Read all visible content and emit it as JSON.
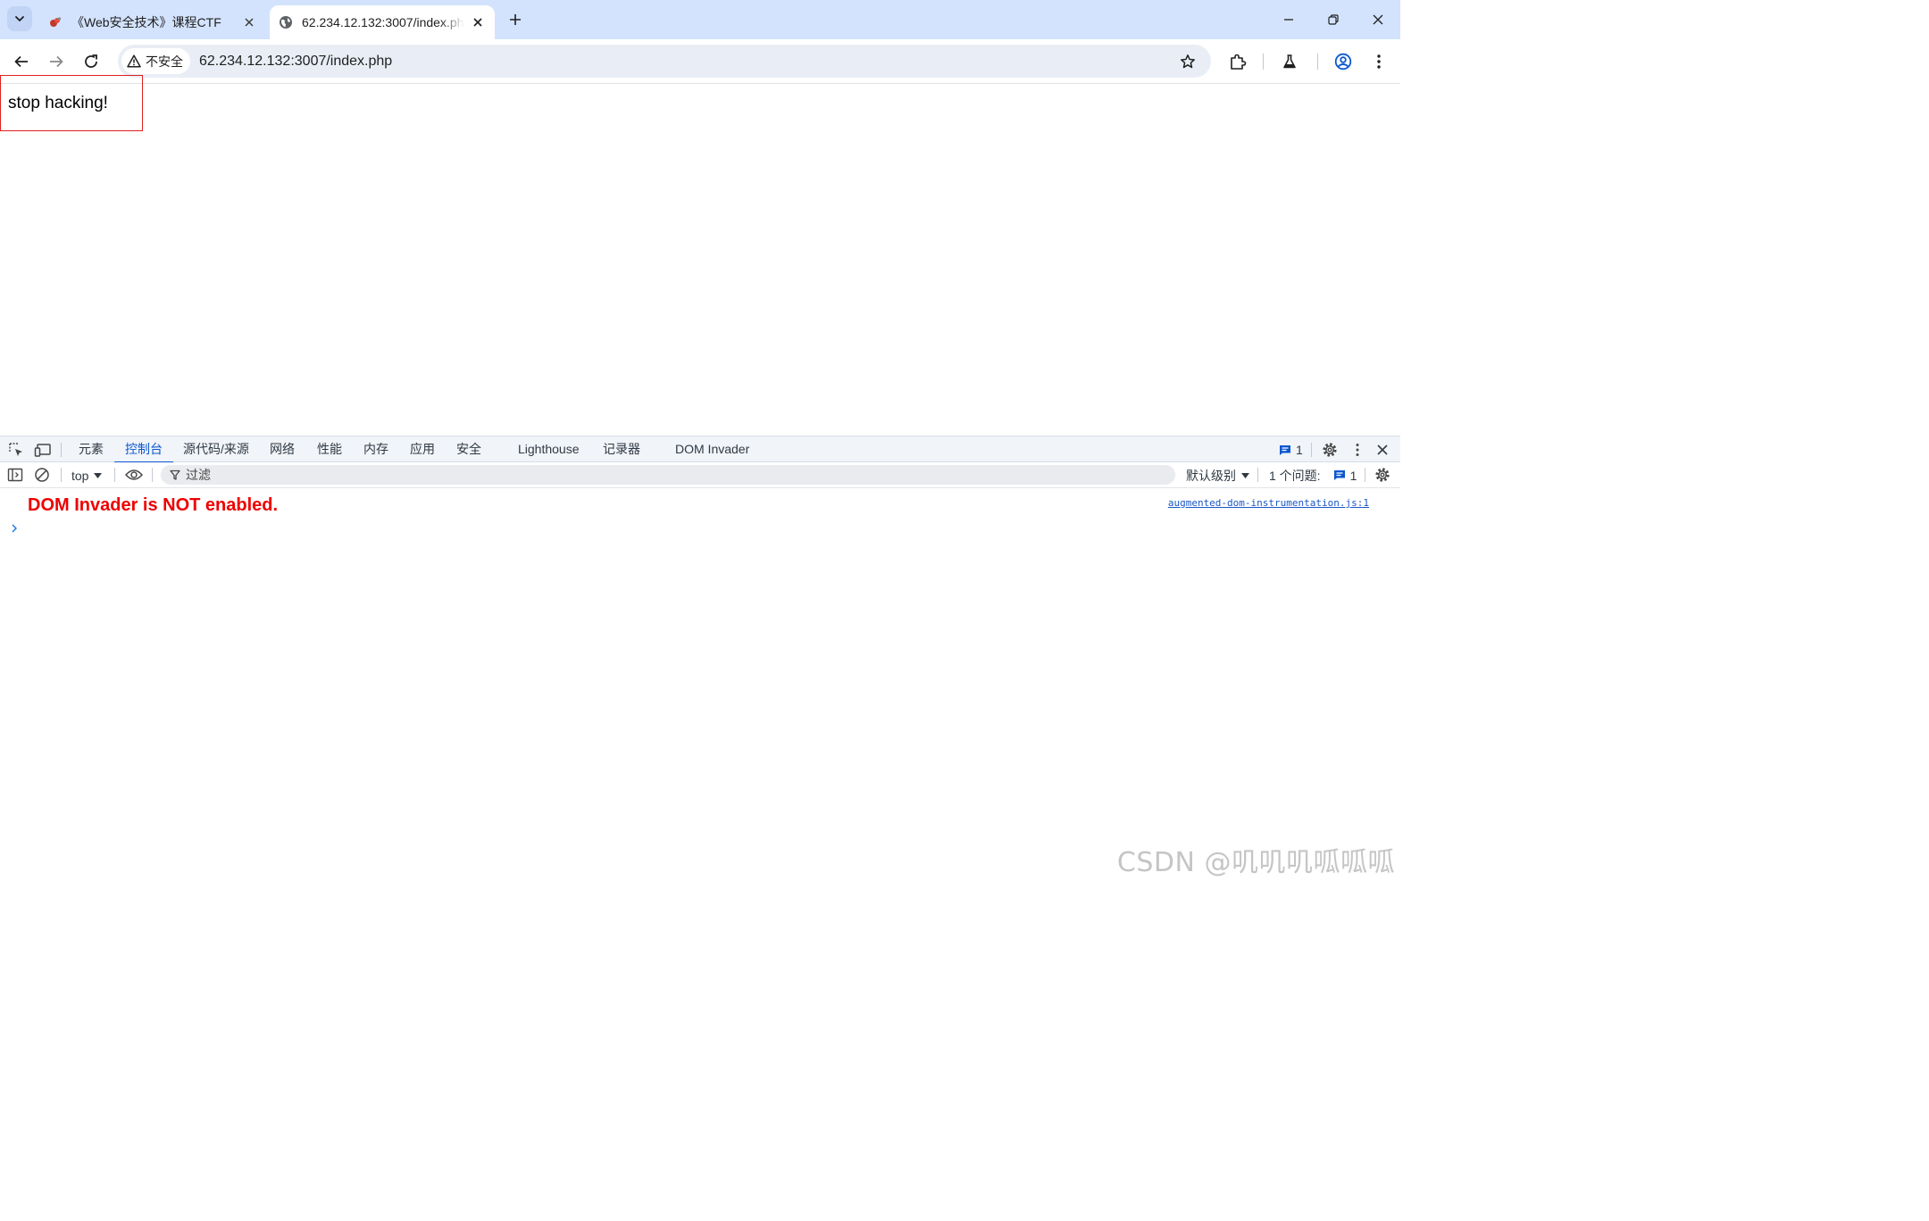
{
  "browser": {
    "tabs": [
      {
        "title": "《Web安全技术》课程CTF",
        "active": false
      },
      {
        "title": "62.234.12.132:3007/index.php",
        "active": true
      }
    ],
    "security_label": "不安全",
    "url": "62.234.12.132:3007/index.php"
  },
  "page": {
    "body_text": "stop hacking!"
  },
  "devtools": {
    "tabs": [
      "元素",
      "控制台",
      "源代码/来源",
      "网络",
      "性能",
      "内存",
      "应用",
      "安全",
      "Lighthouse",
      "记录器",
      "DOM Invader"
    ],
    "active_tab": "控制台",
    "message_count": "1",
    "console": {
      "context": "top",
      "filter_placeholder": "过滤",
      "level": "默认级别",
      "issues_label": "1 个问题:",
      "issues_count": "1",
      "message": "DOM Invader is NOT enabled.",
      "source": "augmented-dom-instrumentation.js:1"
    }
  },
  "watermark": "CSDN @叽叽叽呱呱呱",
  "colors": {
    "tabstrip": "#d3e3fd",
    "accent": "#0b57d0",
    "error_text": "#ee0000",
    "highlight_box": "#e02020"
  }
}
